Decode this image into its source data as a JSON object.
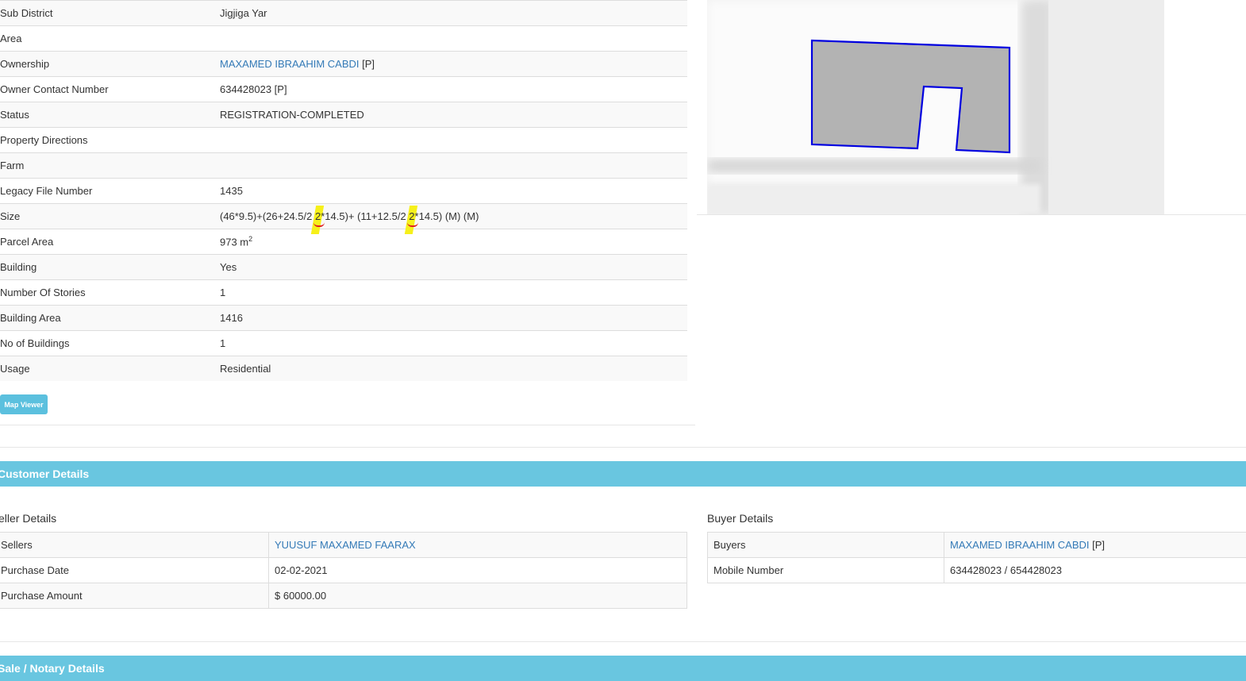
{
  "property": {
    "rows": [
      {
        "label": "Sub District",
        "value": "Jigjiga Yar"
      },
      {
        "label": "Area",
        "value": ""
      },
      {
        "label": "Ownership",
        "value": "MAXAMED IBRAAHIM CABDI",
        "suffix": " [P]"
      },
      {
        "label": "Owner Contact Number",
        "value": "634428023 [P]"
      },
      {
        "label": "Status",
        "value": "REGISTRATION-COMPLETED"
      },
      {
        "label": "Property Directions",
        "value": ""
      },
      {
        "label": "Farm",
        "value": ""
      },
      {
        "label": "Legacy File Number",
        "value": "1435"
      },
      {
        "label": "Size",
        "value_part1": "(46*9.5)+(26+24.5/2 ",
        "value_hl1": "2",
        "value_part2": "*14.5)+ (11+12.5/2 ",
        "value_hl2": "2",
        "value_part3": "*14.5) (M) (M)"
      },
      {
        "label": "Parcel Area",
        "value": "973 m",
        "unit_sup": "2"
      },
      {
        "label": "Building",
        "value": "Yes"
      },
      {
        "label": "Number Of Stories",
        "value": "1"
      },
      {
        "label": "Building Area",
        "value": "1416"
      },
      {
        "label": "No of Buildings",
        "value": "1"
      },
      {
        "label": "Usage",
        "value": "Residential"
      }
    ],
    "map_viewer_label": "Map Viewer"
  },
  "colors": {
    "section_bar": "#69c6e0",
    "link": "#337ab7",
    "parcel_outline": "#0000e0",
    "parcel_fill": "#b3b3b3",
    "highlight": "#f6f01a"
  },
  "customer": {
    "title": "Customer Details",
    "seller": {
      "title": "eller Details",
      "rows": [
        {
          "label": "Sellers",
          "value": "YUUSUF MAXAMED FAARAX"
        },
        {
          "label": "Purchase Date",
          "value": "02-02-2021"
        },
        {
          "label": "Purchase Amount",
          "value": "$ 60000.00"
        }
      ]
    },
    "buyer": {
      "title": "Buyer Details",
      "rows": [
        {
          "label": "Buyers",
          "value": "MAXAMED IBRAAHIM CABDI",
          "suffix": " [P]"
        },
        {
          "label": "Mobile Number",
          "value": "634428023 / 654428023"
        }
      ]
    }
  },
  "sale": {
    "title": "Sale / Notary Details"
  }
}
